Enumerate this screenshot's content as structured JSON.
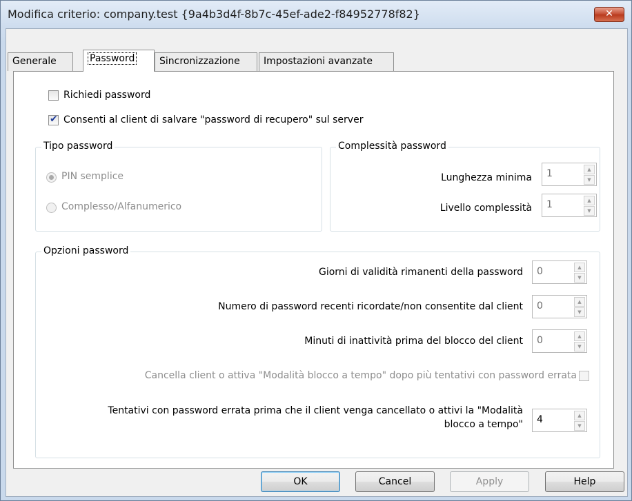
{
  "window": {
    "title": "Modifica criterio:  company.test {9a4b3d4f-8b7c-45ef-ade2-f84952778f82}",
    "close_glyph": "✕"
  },
  "tabs": [
    {
      "label": "Generale"
    },
    {
      "label": "Password"
    },
    {
      "label": "Sincronizzazione"
    },
    {
      "label": "Impostazioni avanzate"
    }
  ],
  "options": {
    "require_password": {
      "label": "Richiedi password",
      "checked": false
    },
    "allow_recovery": {
      "label": "Consenti al client di salvare \"password di recupero\" sul server",
      "checked": true
    }
  },
  "password_type": {
    "title": "Tipo password",
    "simple_pin": "PIN semplice",
    "complex": "Complesso/Alfanumerico"
  },
  "complexity": {
    "title": "Complessità password",
    "min_length_label": "Lunghezza minima",
    "min_length_value": "1",
    "level_label": "Livello complessità",
    "level_value": "1"
  },
  "password_options": {
    "title": "Opzioni password",
    "days_label": "Giorni di validità rimanenti della password",
    "days_value": "0",
    "recent_label": "Numero di password recenti ricordate/non consentite dal client",
    "recent_value": "0",
    "minutes_label": "Minuti di inattività prima del blocco del client",
    "minutes_value": "0",
    "wipe_label": "Cancella client o attiva \"Modalità blocco a tempo\" dopo più tentativi con password errata",
    "attempts_label_1": "Tentativi con password errata prima che il client venga cancellato o attivi la \"Modalità",
    "attempts_label_2": "blocco a tempo\"",
    "attempts_value": "4"
  },
  "buttons": {
    "ok": "OK",
    "cancel": "Cancel",
    "apply": "Apply",
    "help": "Help"
  }
}
